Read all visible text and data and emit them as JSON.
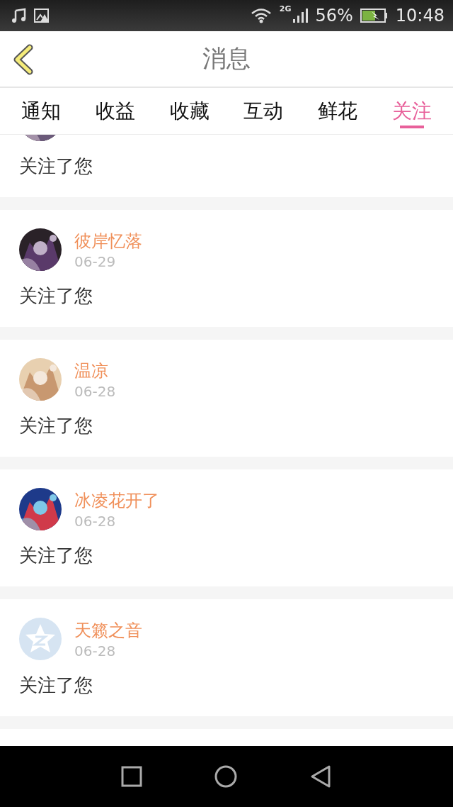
{
  "status_bar": {
    "network": "2G",
    "battery": "56%",
    "time": "10:48"
  },
  "header": {
    "title": "消息"
  },
  "tabs": [
    {
      "label": "通知",
      "selected": false
    },
    {
      "label": "收益",
      "selected": false
    },
    {
      "label": "收藏",
      "selected": false
    },
    {
      "label": "互动",
      "selected": false
    },
    {
      "label": "鲜花",
      "selected": false
    },
    {
      "label": "关注",
      "selected": true
    }
  ],
  "items": [
    {
      "kind": "picture",
      "message": "关注了您"
    },
    {
      "kind": "picture",
      "name": "彼岸忆落",
      "date": "06-29",
      "message": "关注了您"
    },
    {
      "kind": "picture",
      "name": "温凉",
      "date": "06-28",
      "message": "关注了您"
    },
    {
      "kind": "picture",
      "name": "冰凌花开了",
      "date": "06-28",
      "message": "关注了您"
    },
    {
      "kind": "default",
      "name": "天籁之音",
      "date": "06-28",
      "message": "关注了您"
    }
  ]
}
